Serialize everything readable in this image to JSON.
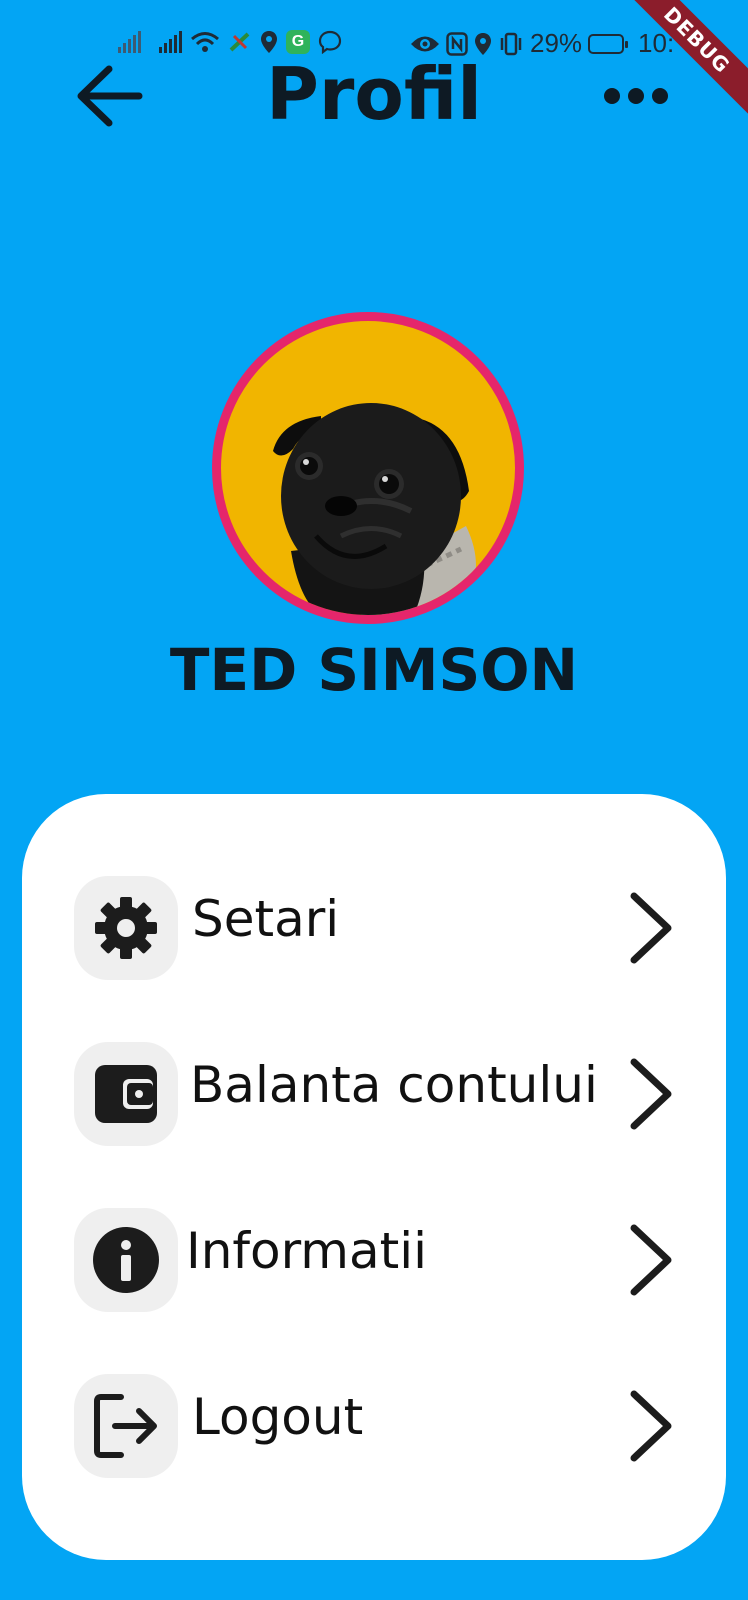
{
  "status_bar": {
    "battery": "29%",
    "time": "10:"
  },
  "debug_banner": "DEBUG",
  "app_bar": {
    "title": "Profil",
    "back_icon": "arrow-left-icon",
    "menu_icon": "more-horizontal-icon"
  },
  "profile": {
    "name": "TED SIMSON",
    "avatar": "pug-dog-photo",
    "colors": {
      "avatar_bg": "#F1B500",
      "avatar_ring": "#E5266B"
    }
  },
  "menu": {
    "items": [
      {
        "label": "Setari",
        "icon": "gear-icon"
      },
      {
        "label": "Balanta contului",
        "icon": "wallet-icon"
      },
      {
        "label": "Informatii",
        "icon": "info-icon"
      },
      {
        "label": "Logout",
        "icon": "logout-icon"
      }
    ],
    "chevron_icon": "chevron-right-icon"
  },
  "colors": {
    "background": "#03A5F4",
    "card": "#FFFFFF",
    "icon_box": "#EFEFEF",
    "text": "#0E1A24"
  }
}
